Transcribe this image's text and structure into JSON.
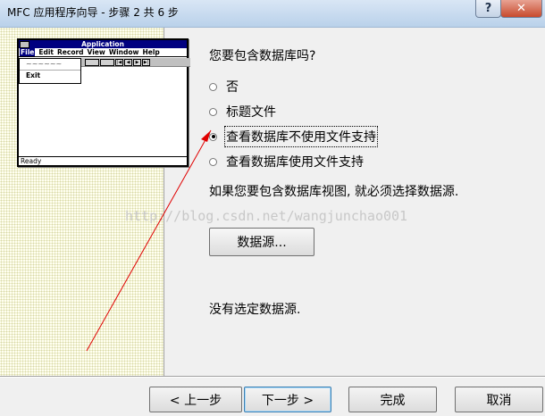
{
  "window": {
    "title": "MFC 应用程序向导 - 步骤 2 共 6 步",
    "help_label": "?",
    "close_label": "✕"
  },
  "illustration": {
    "app_title": "Application",
    "menus": [
      "File",
      "Edit",
      "Record",
      "View",
      "Window",
      "Help"
    ],
    "dropdown_item": "~~~~~~",
    "exit_label": "Exit",
    "status": "Ready",
    "nav_glyphs": [
      "|◀",
      "◀",
      "▶",
      "▶|"
    ]
  },
  "main": {
    "question": "您要包含数据库吗?",
    "options": [
      {
        "label": "否",
        "checked": false
      },
      {
        "label": "标题文件",
        "checked": false
      },
      {
        "label": "查看数据库不使用文件支持",
        "checked": true
      },
      {
        "label": "查看数据库使用文件支持",
        "checked": false
      }
    ],
    "info": "如果您要包含数据库视图, 就必须选择数据源.",
    "watermark": "http://blog.csdn.net/wangjunchao001",
    "datasource_button": "数据源...",
    "datasource_status": "没有选定数据源."
  },
  "buttons": {
    "back": "< 上一步",
    "next": "下一步 >",
    "finish": "完成",
    "cancel": "取消"
  },
  "colors": {
    "annotation_arrow": "#e00000",
    "left_panel_bg": "#fffff0"
  }
}
